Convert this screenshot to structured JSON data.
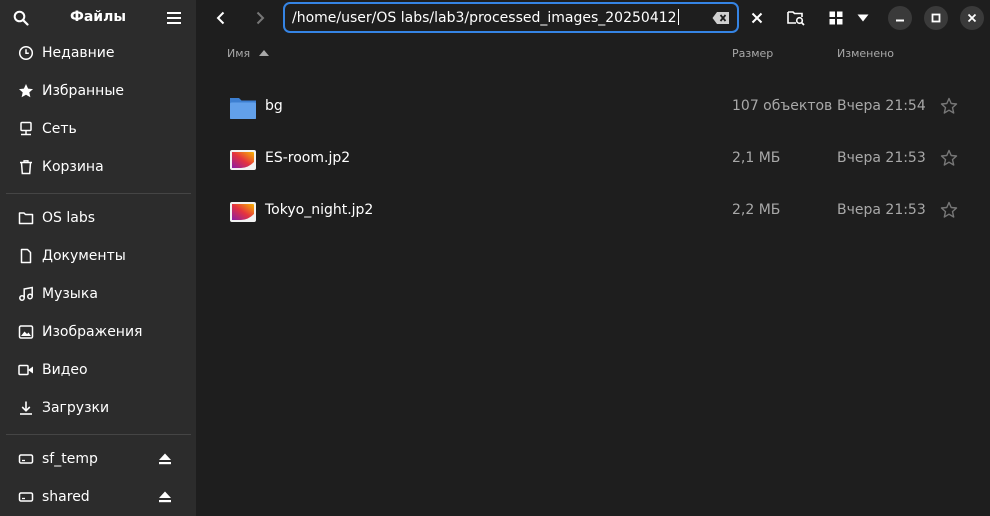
{
  "sidebar": {
    "title": "Файлы",
    "places": [
      {
        "label": "Недавние",
        "icon": "recent-icon"
      },
      {
        "label": "Избранные",
        "icon": "star-icon"
      },
      {
        "label": "Сеть",
        "icon": "network-icon"
      },
      {
        "label": "Корзина",
        "icon": "trash-icon"
      }
    ],
    "bookmarks": [
      {
        "label": "OS labs",
        "icon": "folder-icon"
      },
      {
        "label": "Документы",
        "icon": "document-icon"
      },
      {
        "label": "Музыка",
        "icon": "music-icon"
      },
      {
        "label": "Изображения",
        "icon": "image-icon"
      },
      {
        "label": "Видео",
        "icon": "video-icon"
      },
      {
        "label": "Загрузки",
        "icon": "download-icon"
      }
    ],
    "drives": [
      {
        "label": "sf_temp",
        "icon": "drive-icon"
      },
      {
        "label": "shared",
        "icon": "drive-icon"
      }
    ]
  },
  "location": {
    "path": "/home/user/OS labs/lab3/processed_images_20250412"
  },
  "columns": {
    "name": "Имя",
    "size": "Размер",
    "modified": "Изменено"
  },
  "files": [
    {
      "name": "bg",
      "type": "folder",
      "size": "107 объектов",
      "modified": "Вчера 21:54"
    },
    {
      "name": "ES-room.jp2",
      "type": "image",
      "size": "2,1 МБ",
      "modified": "Вчера 21:53"
    },
    {
      "name": "Tokyo_night.jp2",
      "type": "image",
      "size": "2,2 МБ",
      "modified": "Вчера 21:53"
    }
  ],
  "colors": {
    "accent": "#3584e4",
    "sidebar_bg": "#2c2c2c",
    "content_bg": "#1e1e1e",
    "folder": "#62a0ea"
  }
}
